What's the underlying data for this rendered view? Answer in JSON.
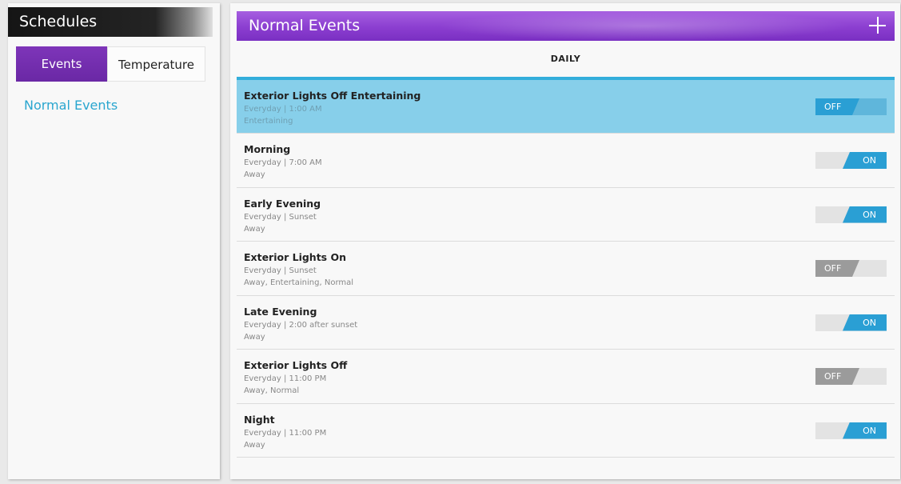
{
  "sidebar": {
    "title": "Schedules",
    "tabs": [
      {
        "label": "Events",
        "active": true
      },
      {
        "label": "Temperature",
        "active": false
      }
    ],
    "link": "Normal Events"
  },
  "main": {
    "title": "Normal Events",
    "add_icon": "plus-icon",
    "section_label": "DAILY",
    "events": [
      {
        "title": "Exterior Lights Off Entertaining",
        "schedule": "Everyday | 1:00 AM",
        "modes": "Entertaining",
        "state": "OFF",
        "selected": true
      },
      {
        "title": "Morning",
        "schedule": "Everyday | 7:00 AM",
        "modes": "Away",
        "state": "ON",
        "selected": false
      },
      {
        "title": "Early Evening",
        "schedule": "Everyday | Sunset",
        "modes": "Away",
        "state": "ON",
        "selected": false
      },
      {
        "title": "Exterior Lights On",
        "schedule": "Everyday | Sunset",
        "modes": "Away, Entertaining, Normal",
        "state": "OFF",
        "selected": false
      },
      {
        "title": "Late Evening",
        "schedule": "Everyday | 2:00 after sunset",
        "modes": "Away",
        "state": "ON",
        "selected": false
      },
      {
        "title": "Exterior Lights Off",
        "schedule": "Everyday | 11:00 PM",
        "modes": "Away, Normal",
        "state": "OFF",
        "selected": false
      },
      {
        "title": "Night",
        "schedule": "Everyday | 11:00 PM",
        "modes": "Away",
        "state": "ON",
        "selected": false
      }
    ]
  },
  "colors": {
    "accent_purple": "#7e35b9",
    "accent_blue": "#33aedb",
    "selected_row": "#87cfea",
    "toggle_on": "#2a9fd4",
    "toggle_off": "#9b9b9b"
  }
}
